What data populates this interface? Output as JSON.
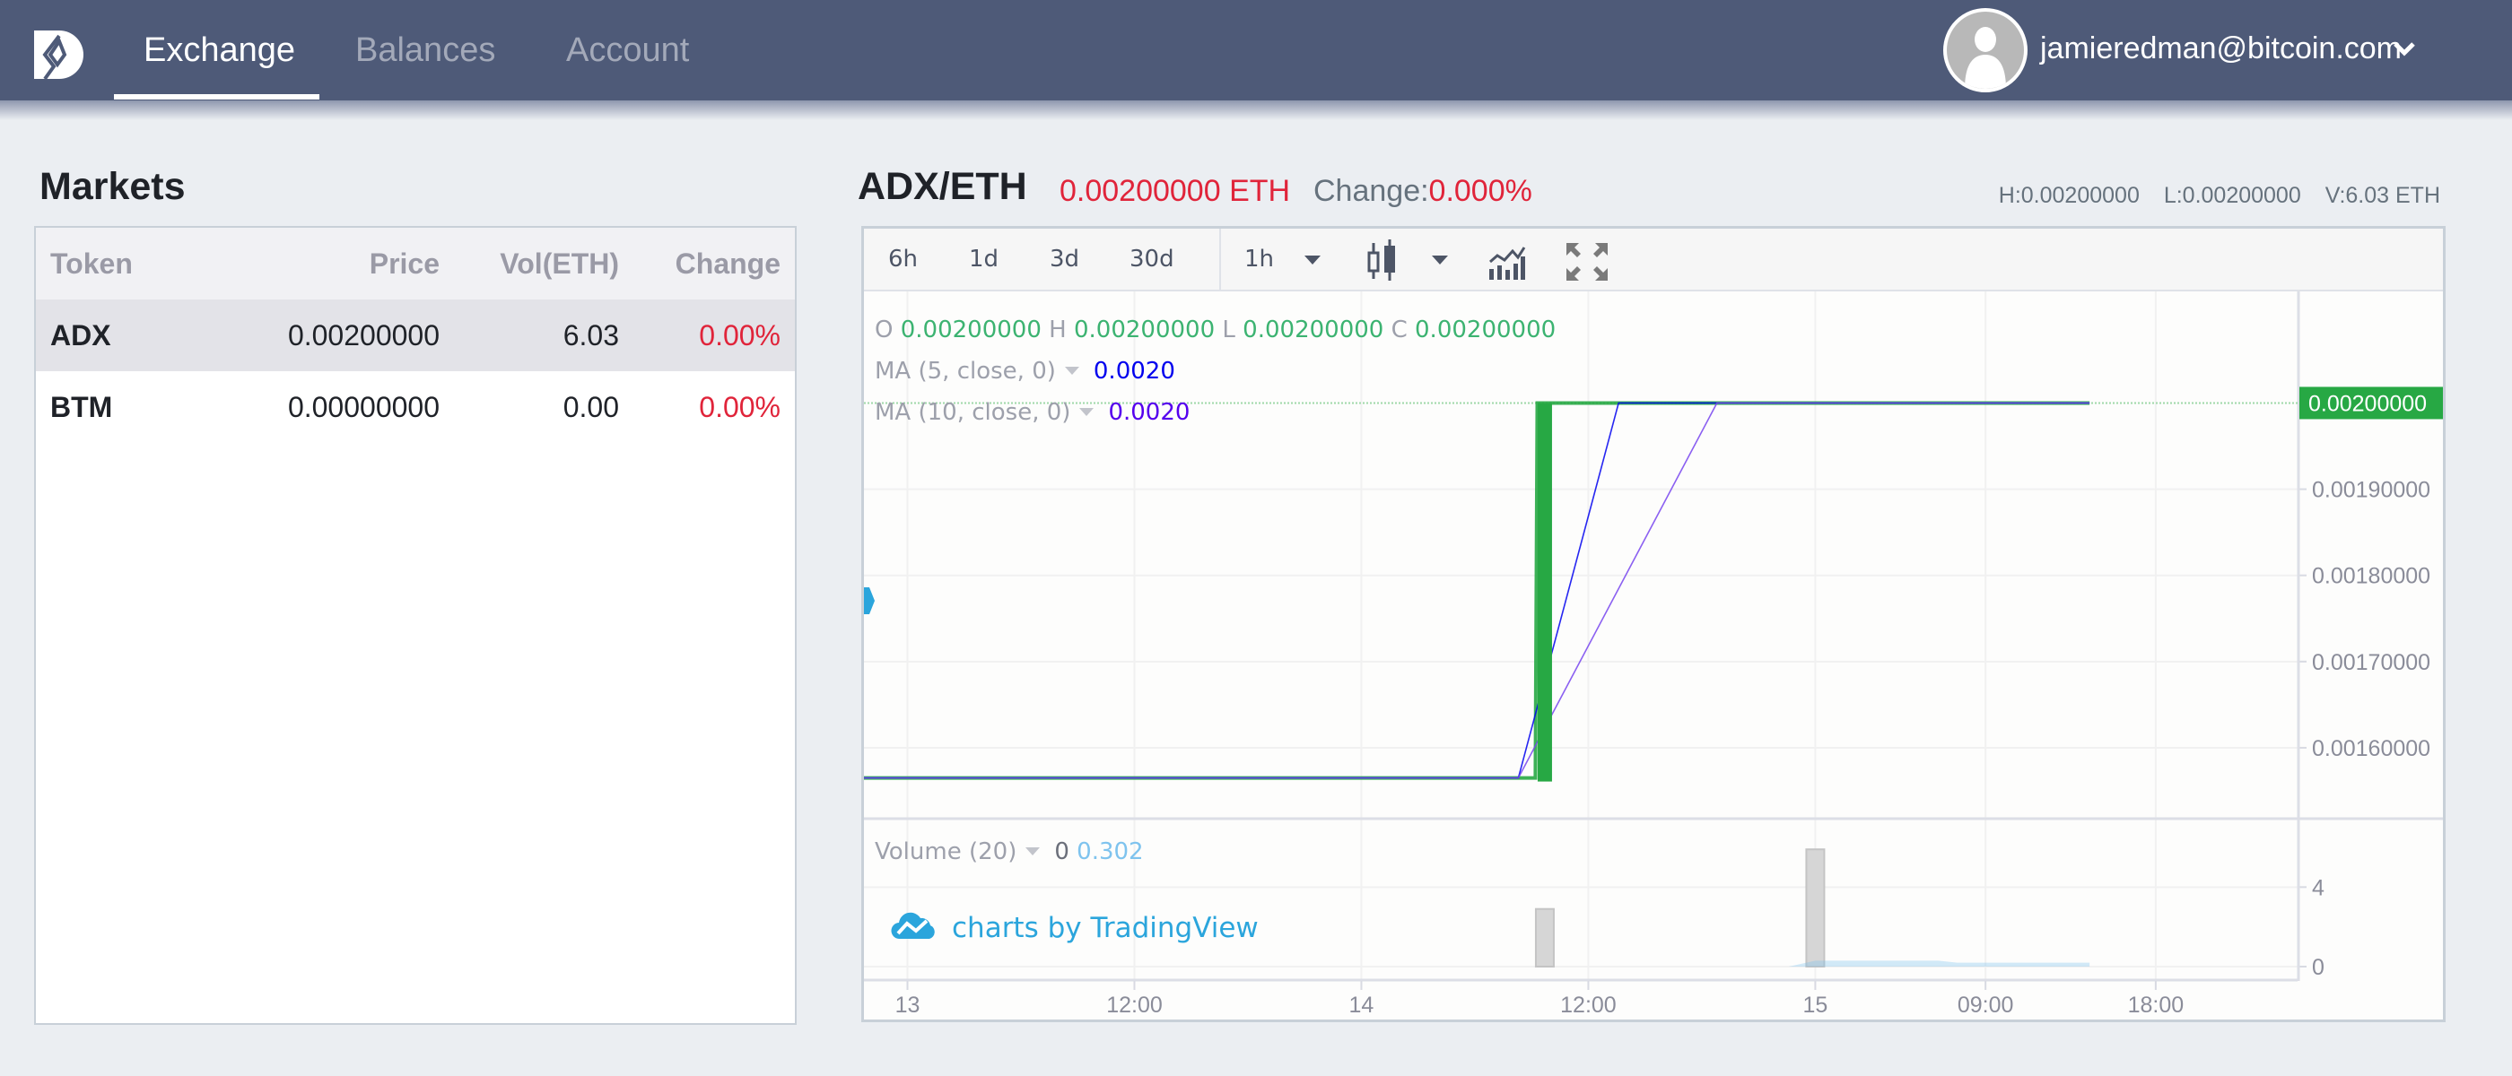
{
  "header": {
    "nav": [
      {
        "label": "Exchange",
        "active": true
      },
      {
        "label": "Balances",
        "active": false
      },
      {
        "label": "Account",
        "active": false
      }
    ],
    "user_email": "jamieredman@bitcoin.com",
    "icons": {
      "logo": "diamond-d-logo",
      "avatar": "user-silhouette-icon",
      "chevron": "chevron-down-icon"
    }
  },
  "markets": {
    "title": "Markets",
    "columns": [
      "Token",
      "Price",
      "Vol(ETH)",
      "Change"
    ],
    "rows": [
      {
        "token": "ADX",
        "price": "0.00200000",
        "vol": "6.03",
        "change": "0.00%",
        "selected": true
      },
      {
        "token": "BTM",
        "price": "0.00000000",
        "vol": "0.00",
        "change": "0.00%",
        "selected": false
      }
    ]
  },
  "ticker": {
    "pair": "ADX/ETH",
    "price": "0.00200000 ETH",
    "change_label": "Change:",
    "change_value": "0.000%",
    "high": "H:0.00200000",
    "low": "L:0.00200000",
    "volume": "V:6.03 ETH"
  },
  "toolbar": {
    "ranges": [
      "6h",
      "1d",
      "3d",
      "30d"
    ],
    "interval": "1h",
    "icons": [
      "caret-down-icon",
      "candlestick-icon",
      "caret-down-icon",
      "indicators-icon",
      "fullscreen-icon"
    ]
  },
  "legend": {
    "o_label": "O",
    "o": "0.00200000",
    "h_label": "H",
    "h": "0.00200000",
    "l_label": "L",
    "l": "0.00200000",
    "c_label": "C",
    "c": "0.00200000",
    "ma5_label": "MA (5, close, 0)",
    "ma5": "0.0020",
    "ma10_label": "MA (10, close, 0)",
    "ma10": "0.0020",
    "volume_label": "Volume (20)",
    "volume_val": "0",
    "volume_ma": "0.302"
  },
  "branding": "charts by TradingView",
  "colors": {
    "header_bg": "#4e5a78",
    "negative": "#e0243a",
    "up": "#27a844",
    "ma5": "#0000ee",
    "ma10": "#7744ee",
    "volume_ma": "#7ec3ee"
  },
  "chart_data": {
    "type": "line",
    "title": "ADX/ETH",
    "price_axis": {
      "ticks": [
        "0.00160000",
        "0.00170000",
        "0.00180000",
        "0.00190000"
      ],
      "range": [
        0.00155,
        0.00204
      ],
      "last_price_label": "0.00200000"
    },
    "volume_axis": {
      "ticks": [
        "0",
        "4"
      ],
      "range": [
        0,
        6
      ]
    },
    "time_axis": {
      "ticks": [
        "13",
        "12:00",
        "14",
        "12:00",
        "15",
        "09:00",
        "18:00"
      ],
      "tick_hours": [
        0,
        12,
        24,
        36,
        48,
        57,
        66
      ],
      "range_hours": [
        -2.3,
        73.5
      ]
    },
    "series": [
      {
        "name": "Close",
        "points": [
          [
            -2.3,
            0.001565
          ],
          [
            33.2,
            0.001565
          ],
          [
            33.3,
            0.002
          ],
          [
            62.5,
            0.002
          ]
        ]
      },
      {
        "name": "MA (5, close, 0)",
        "points": [
          [
            -2.3,
            0.001565
          ],
          [
            32.3,
            0.001565
          ],
          [
            37.6,
            0.002
          ],
          [
            62.5,
            0.002
          ]
        ]
      },
      {
        "name": "MA (10, close, 0)",
        "points": [
          [
            -2.3,
            0.001565
          ],
          [
            32.3,
            0.001565
          ],
          [
            42.8,
            0.002
          ],
          [
            62.5,
            0.002
          ]
        ]
      }
    ],
    "candles": [
      {
        "t": 33.7,
        "open": 0.001565,
        "high": 0.002,
        "low": 0.001565,
        "close": 0.002
      }
    ],
    "volume_bars": [
      {
        "t": 33.7,
        "value": 2.9
      },
      {
        "t": 48.0,
        "value": 5.9
      }
    ],
    "volume_ma": [
      [
        -2.3,
        0.0
      ],
      [
        46.6,
        0.0
      ],
      [
        48.0,
        0.3
      ],
      [
        54.5,
        0.3
      ],
      [
        55.5,
        0.2
      ],
      [
        62.5,
        0.2
      ]
    ]
  }
}
